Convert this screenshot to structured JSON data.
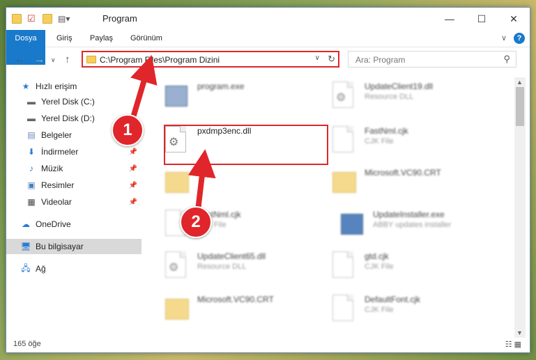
{
  "window": {
    "title": "Program",
    "controls": {
      "minimize": "—",
      "maximize": "☐",
      "close": "✕"
    }
  },
  "ribbon": {
    "tabs": [
      "Dosya",
      "Giriş",
      "Paylaş",
      "Görünüm"
    ],
    "collapse": "∨",
    "help": "?"
  },
  "address": {
    "path": "C:\\Program Files\\Program Dizini",
    "dropdown": "∨",
    "refresh": "↻"
  },
  "search": {
    "placeholder": "Ara: Program",
    "icon": "search-icon"
  },
  "nav": {
    "back": "←",
    "forward": "→",
    "recent": "∨",
    "up": "↑"
  },
  "sidebar": {
    "items": [
      {
        "label": "Hızlı erişim",
        "icon": "star-icon",
        "pinned": false
      },
      {
        "label": "Yerel Disk (C:)",
        "icon": "drive-icon",
        "pinned": false
      },
      {
        "label": "Yerel Disk (D:)",
        "icon": "drive-icon",
        "pinned": false
      },
      {
        "label": "Belgeler",
        "icon": "documents-icon",
        "pinned": false
      },
      {
        "label": "İndirmeler",
        "icon": "download-icon",
        "pinned": true
      },
      {
        "label": "Müzik",
        "icon": "music-icon",
        "pinned": true
      },
      {
        "label": "Resimler",
        "icon": "pictures-icon",
        "pinned": true
      },
      {
        "label": "Videolar",
        "icon": "video-icon",
        "pinned": true
      },
      {
        "label": "OneDrive",
        "icon": "cloud-icon",
        "pinned": false
      },
      {
        "label": "Bu bilgisayar",
        "icon": "computer-icon",
        "pinned": false,
        "selected": true
      },
      {
        "label": "Ağ",
        "icon": "network-icon",
        "pinned": false
      }
    ]
  },
  "files": [
    {
      "name": "program.exe",
      "desc": "",
      "icon": "exe-icon"
    },
    {
      "name": "UpdateClient19.dll",
      "desc": "Resource DLL",
      "icon": "dll-icon"
    },
    {
      "name": "pxdmp3enc.dll",
      "desc": "",
      "icon": "dll-icon",
      "highlighted": true
    },
    {
      "name": "FastNml.cjk",
      "desc": "CJK File",
      "icon": "file-icon"
    },
    {
      "name": "",
      "desc": "",
      "icon": "folder-icon"
    },
    {
      "name": "Microsoft.VC90.CRT",
      "desc": "",
      "icon": "folder-icon"
    },
    {
      "name": "FastNml.cjk",
      "desc": "CJK File",
      "icon": "file-icon"
    },
    {
      "name": "UpdateInstaller.exe",
      "desc": "ABBY updates installer",
      "icon": "installer-icon"
    },
    {
      "name": "UpdateClient65.dll",
      "desc": "Resource DLL",
      "icon": "dll-icon"
    },
    {
      "name": "gtd.cjk",
      "desc": "CJK File",
      "icon": "file-icon"
    },
    {
      "name": "Microsoft.VC90.CRT",
      "desc": "",
      "icon": "folder-icon"
    },
    {
      "name": "DefaultFont.cjk",
      "desc": "CJK File",
      "icon": "file-icon"
    }
  ],
  "status": {
    "count": "165 öğe",
    "views": "☷ ▦"
  },
  "annotations": {
    "step1": "1",
    "step2": "2"
  }
}
